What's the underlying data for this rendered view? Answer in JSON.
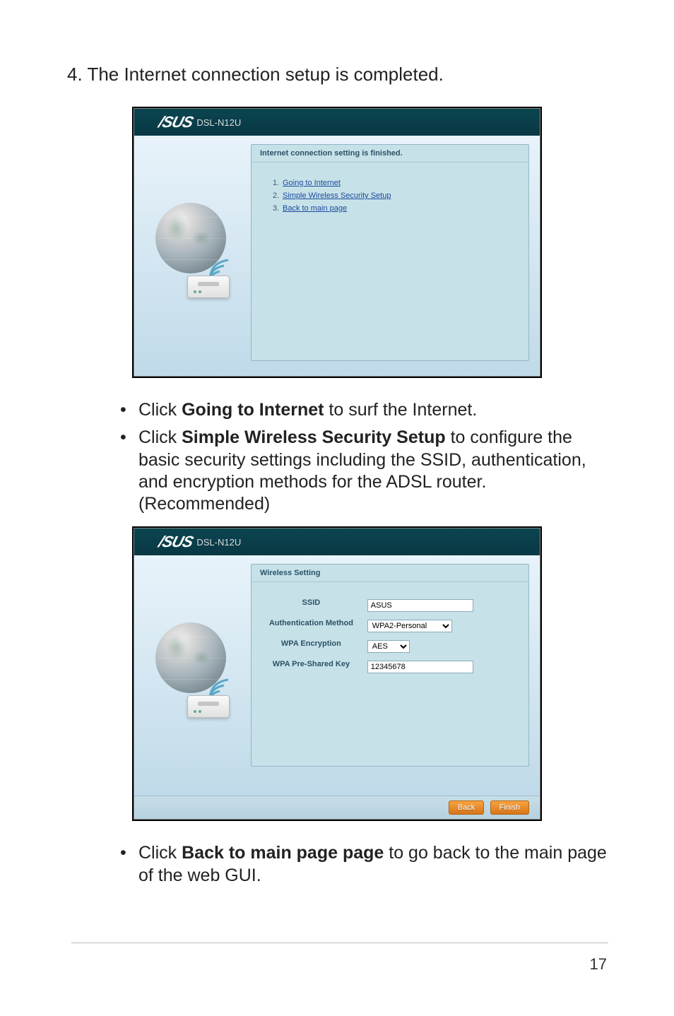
{
  "step4": "4.  The Internet connection setup is completed.",
  "model": "DSL-N12U",
  "panel1": {
    "title": "Internet connection setting is finished.",
    "links": [
      {
        "num": "1.",
        "text": "Going to Internet"
      },
      {
        "num": "2.",
        "text": "Simple Wireless Security Setup"
      },
      {
        "num": "3.",
        "text": "Back to main page"
      }
    ]
  },
  "bullets1": [
    {
      "pre": "Click ",
      "bold": "Going to Internet",
      "post": " to surf the Internet."
    },
    {
      "pre": "Click ",
      "bold": "Simple Wireless Security Setup",
      "post": " to configure the basic security settings including the SSID, authentication, and encryption methods for the ADSL router. (Recommended)"
    }
  ],
  "panel2": {
    "title": "Wireless Setting",
    "fields": {
      "ssid_label": "SSID",
      "ssid_value": "ASUS",
      "auth_label": "Authentication Method",
      "auth_value": "WPA2-Personal",
      "enc_label": "WPA Encryption",
      "enc_value": "AES",
      "key_label": "WPA Pre-Shared Key",
      "key_value": "12345678"
    },
    "back": "Back",
    "finish": "Finish"
  },
  "bullets2": [
    {
      "pre": "Click ",
      "bold": "Back to main page page",
      "post": " to go back to the main page of the web GUI."
    }
  ],
  "pagenum": "17"
}
